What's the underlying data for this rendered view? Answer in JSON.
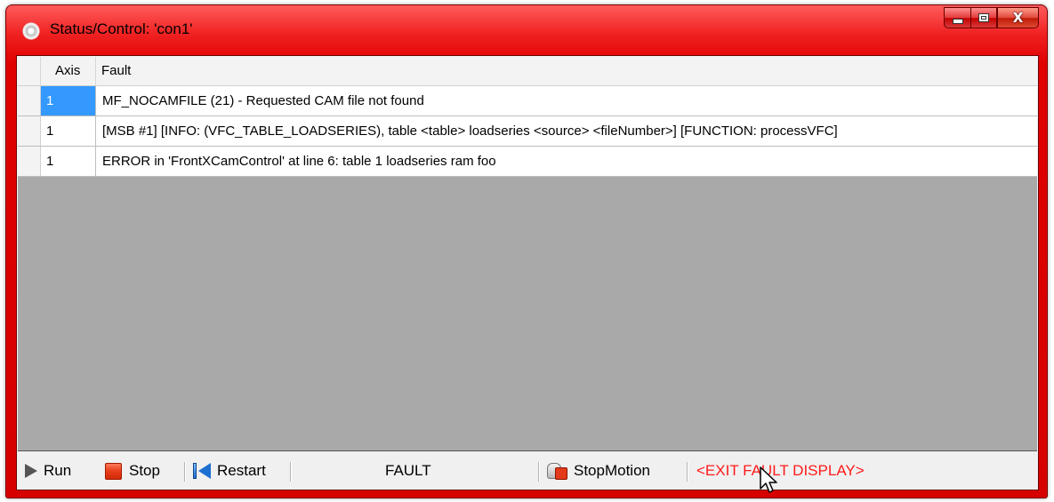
{
  "window": {
    "title": "Status/Control: 'con1'",
    "icon": "gear-icon",
    "controls": {
      "minimize": "minimize-icon",
      "maximize": "maximize-icon",
      "close_label": "X"
    }
  },
  "grid": {
    "columns": [
      "Axis",
      "Fault"
    ],
    "rows": [
      {
        "axis": "1",
        "fault": "MF_NOCAMFILE (21) - Requested CAM file not found",
        "selected": true
      },
      {
        "axis": "1",
        "fault": "[MSB #1] [INFO:  (VFC_TABLE_LOADSERIES), table <table> loadseries <source> <fileNumber>] [FUNCTION:  processVFC]",
        "selected": false
      },
      {
        "axis": "1",
        "fault": "ERROR in 'FrontXCamControl' at line 6:  table 1 loadseries ram foo",
        "selected": false
      }
    ]
  },
  "statusbar": {
    "run_label": "Run",
    "stop_label": "Stop",
    "restart_label": "Restart",
    "state_text": "FAULT",
    "stopmotion_label": "StopMotion",
    "exit_fault_label": "<EXIT FAULT DISPLAY>"
  },
  "colors": {
    "titlebar": "#d60000",
    "selection": "#3399ff",
    "exit_fault_text": "#ff1a1a",
    "grid_background": "#a9a9a9"
  }
}
